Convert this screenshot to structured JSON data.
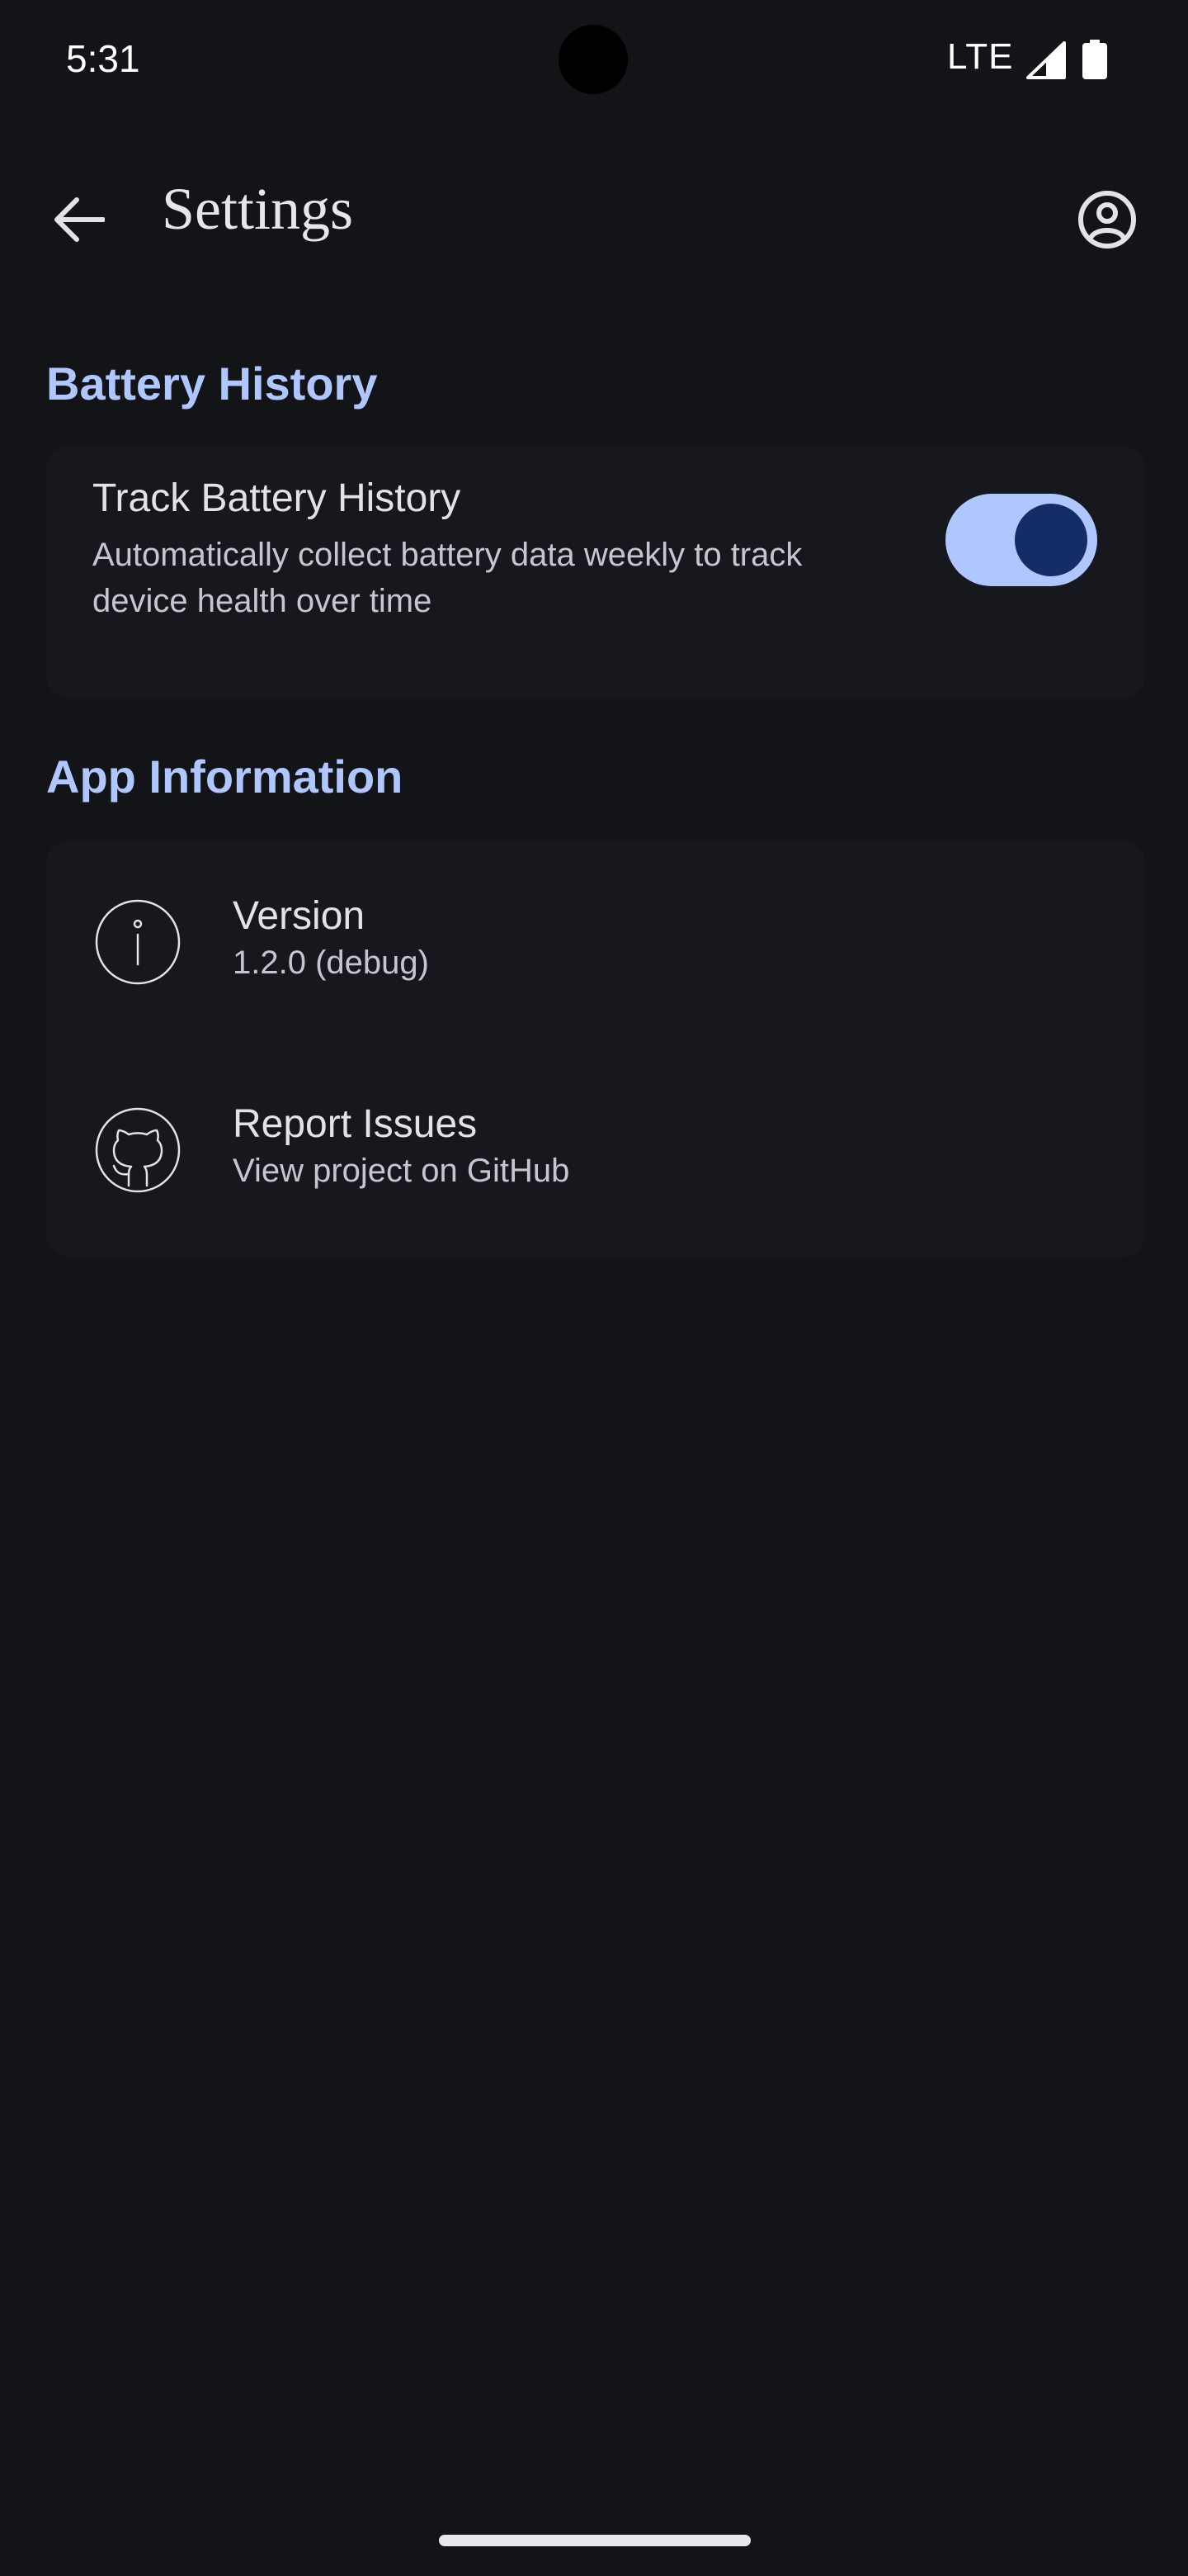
{
  "status_bar": {
    "time": "5:31",
    "network": "LTE"
  },
  "app_bar": {
    "title": "Settings",
    "back_icon": "arrow-back-icon",
    "account_icon": "account-circle-icon"
  },
  "battery_section": {
    "header": "Battery History",
    "track_setting": {
      "title": "Track Battery History",
      "description": "Automatically collect battery data weekly to track device health over time",
      "enabled": true
    }
  },
  "info_section": {
    "header": "App Information",
    "items": [
      {
        "title": "Version",
        "subtitle": "1.2.0 (debug)",
        "icon": "info-icon"
      },
      {
        "title": "Report Issues",
        "subtitle": "View project on GitHub",
        "icon": "github-icon"
      }
    ]
  },
  "colors": {
    "background": "#131418",
    "card": "#17181d",
    "accent": "#b0c6ff",
    "toggle_thumb": "#142d66",
    "text_primary": "#e3e2e6",
    "text_secondary": "#c5c6d0"
  }
}
